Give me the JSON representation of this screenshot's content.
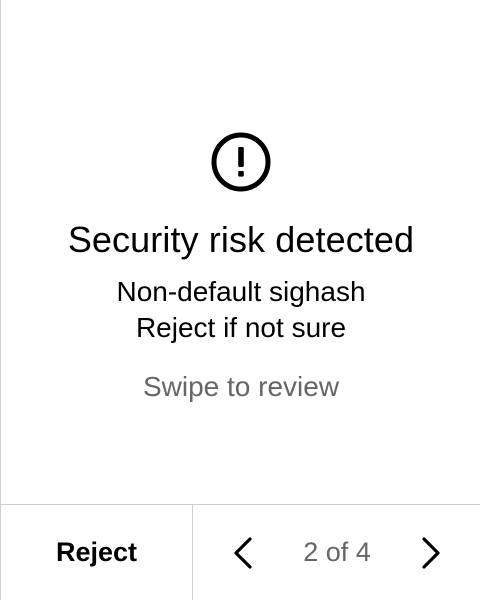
{
  "warning": {
    "icon": "alert-circle-icon",
    "title": "Security risk detected",
    "message_line_1": "Non-default sighash",
    "message_line_2": "Reject if not sure",
    "hint": "Swipe to review"
  },
  "footer": {
    "reject_label": "Reject",
    "prev_icon": "chevron-left-icon",
    "next_icon": "chevron-right-icon",
    "page_indicator": "2 of 4"
  },
  "colors": {
    "text_primary": "#000000",
    "text_secondary": "#666666",
    "divider": "#cfcfcf",
    "background": "#ffffff"
  }
}
